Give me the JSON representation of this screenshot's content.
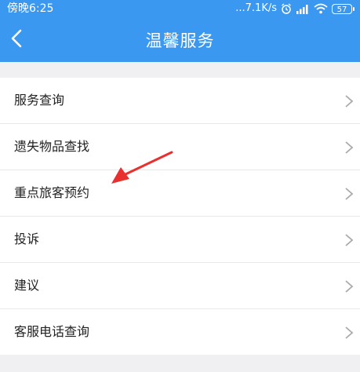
{
  "status_bar": {
    "time": "傍晚6:25",
    "net_speed": "...7.1K/s",
    "battery": "57"
  },
  "header": {
    "title": "温馨服务"
  },
  "menu": {
    "items": [
      {
        "label": "服务查询"
      },
      {
        "label": "遗失物品查找"
      },
      {
        "label": "重点旅客预约"
      },
      {
        "label": "投诉"
      },
      {
        "label": "建议"
      },
      {
        "label": "客服电话查询"
      }
    ]
  },
  "colors": {
    "header": "#3a98f0",
    "background": "#f0f0f2",
    "annotation_arrow": "#e8312f"
  }
}
